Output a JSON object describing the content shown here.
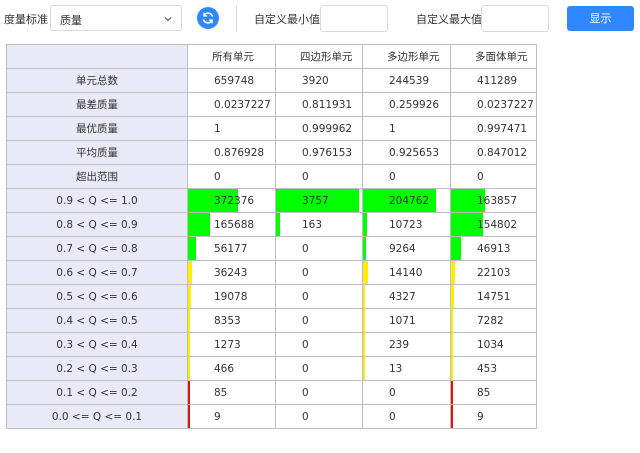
{
  "toolbar": {
    "metric_label": "度量标准",
    "metric_value": "质量",
    "min_label": "自定义最小值",
    "min_value": "",
    "max_label": "自定义最大值",
    "max_value": "",
    "show_label": "显示",
    "icons": {
      "dropdown": "chevron-down-icon",
      "refresh": "refresh-icon"
    },
    "colors": {
      "accent": "#2f88ff"
    }
  },
  "table": {
    "columns": [
      "所有单元",
      "四边形单元",
      "多边形单元",
      "多面体单元"
    ],
    "stat_rows": [
      {
        "label": "单元总数",
        "values": [
          "659748",
          "3920",
          "244539",
          "411289"
        ]
      },
      {
        "label": "最差质量",
        "values": [
          "0.0237227",
          "0.811931",
          "0.259926",
          "0.0237227"
        ]
      },
      {
        "label": "最优质量",
        "values": [
          "1",
          "0.999962",
          "1",
          "0.997471"
        ]
      },
      {
        "label": "平均质量",
        "values": [
          "0.876928",
          "0.976153",
          "0.925653",
          "0.847012"
        ]
      },
      {
        "label": "超出范围",
        "values": [
          "0",
          "0",
          "0",
          "0"
        ]
      }
    ],
    "hist_rows": [
      {
        "label": "0.9 < Q <= 1.0",
        "color": "#00ff00",
        "values": [
          "372376",
          "3757",
          "204762",
          "163857"
        ],
        "fractions": [
          0.57,
          0.96,
          0.84,
          0.4
        ]
      },
      {
        "label": "0.8 < Q <= 0.9",
        "color": "#00ff00",
        "values": [
          "165688",
          "163",
          "10723",
          "154802"
        ],
        "fractions": [
          0.25,
          0.05,
          0.05,
          0.38
        ]
      },
      {
        "label": "0.7 < Q <= 0.8",
        "color": "#00ff00",
        "values": [
          "56177",
          "0",
          "9264",
          "46913"
        ],
        "fractions": [
          0.09,
          0,
          0.04,
          0.12
        ]
      },
      {
        "label": "0.6 < Q <= 0.7",
        "color": "#ffee00",
        "values": [
          "36243",
          "0",
          "14140",
          "22103"
        ],
        "fractions": [
          0.05,
          0,
          0.06,
          0.05
        ]
      },
      {
        "label": "0.5 < Q <= 0.6",
        "color": "#ffee00",
        "values": [
          "19078",
          "0",
          "4327",
          "14751"
        ],
        "fractions": [
          0.03,
          0,
          0.02,
          0.04
        ]
      },
      {
        "label": "0.4 < Q <= 0.5",
        "color": "#ffee00",
        "values": [
          "8353",
          "0",
          "1071",
          "7282"
        ],
        "fractions": [
          0.02,
          0,
          0.02,
          0.02
        ]
      },
      {
        "label": "0.3 < Q <= 0.4",
        "color": "#ffee00",
        "values": [
          "1273",
          "0",
          "239",
          "1034"
        ],
        "fractions": [
          0.02,
          0,
          0.02,
          0.02
        ]
      },
      {
        "label": "0.2 < Q <= 0.3",
        "color": "#ffee00",
        "values": [
          "466",
          "0",
          "13",
          "453"
        ],
        "fractions": [
          0.02,
          0,
          0.02,
          0.02
        ]
      },
      {
        "label": "0.1 < Q <= 0.2",
        "color": "#dd1111",
        "values": [
          "85",
          "0",
          "0",
          "85"
        ],
        "fractions": [
          0.02,
          0,
          0,
          0.02
        ]
      },
      {
        "label": "0.0 <= Q <= 0.1",
        "color": "#dd1111",
        "values": [
          "9",
          "0",
          "0",
          "9"
        ],
        "fractions": [
          0.02,
          0,
          0,
          0.02
        ]
      }
    ]
  }
}
